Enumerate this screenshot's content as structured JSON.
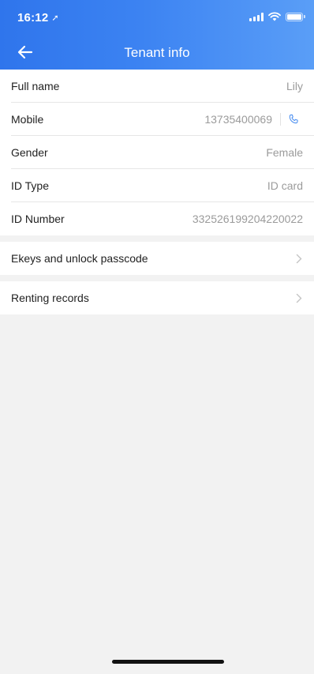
{
  "status_bar": {
    "time": "16:12"
  },
  "nav": {
    "title": "Tenant info"
  },
  "info": {
    "full_name": {
      "label": "Full name",
      "value": "Lily"
    },
    "mobile": {
      "label": "Mobile",
      "value": "13735400069"
    },
    "gender": {
      "label": "Gender",
      "value": "Female"
    },
    "id_type": {
      "label": "ID Type",
      "value": "ID card"
    },
    "id_number": {
      "label": "ID Number",
      "value": "332526199204220022"
    }
  },
  "links": {
    "ekeys": {
      "label": "Ekeys and unlock passcode"
    },
    "renting_records": {
      "label": "Renting records"
    }
  },
  "colors": {
    "header_start": "#2f75ec",
    "header_end": "#5a9ef7",
    "accent_phone": "#4a8ef0",
    "background": "#f2f2f2"
  }
}
